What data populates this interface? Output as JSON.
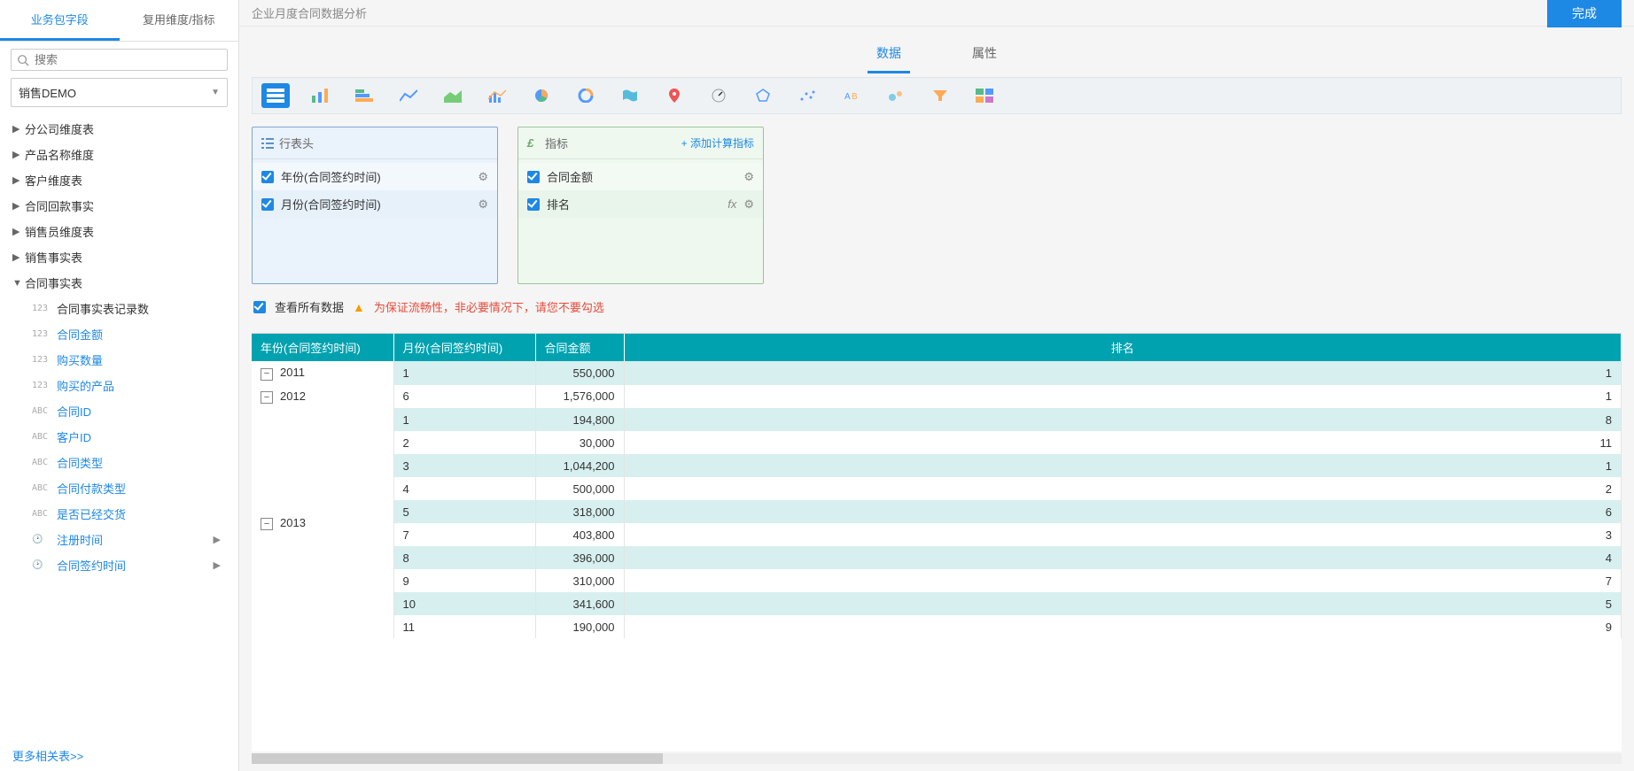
{
  "sidebar": {
    "tabs": [
      "业务包字段",
      "复用维度/指标"
    ],
    "active_tab": 0,
    "search_placeholder": "搜索",
    "dataset_select": "销售DEMO",
    "tree": [
      {
        "label": "分公司维度表",
        "open": false
      },
      {
        "label": "产品名称维度",
        "open": false
      },
      {
        "label": "客户维度表",
        "open": false
      },
      {
        "label": "合同回款事实",
        "open": false
      },
      {
        "label": "销售员维度表",
        "open": false
      },
      {
        "label": "销售事实表",
        "open": false
      },
      {
        "label": "合同事实表",
        "open": true,
        "children": [
          {
            "type": "123",
            "label": "合同事实表记录数",
            "plain": true
          },
          {
            "type": "123",
            "label": "合同金额"
          },
          {
            "type": "123",
            "label": "购买数量"
          },
          {
            "type": "123",
            "label": "购买的产品"
          },
          {
            "type": "ABC",
            "label": "合同ID"
          },
          {
            "type": "ABC",
            "label": "客户ID"
          },
          {
            "type": "ABC",
            "label": "合同类型"
          },
          {
            "type": "ABC",
            "label": "合同付款类型"
          },
          {
            "type": "ABC",
            "label": "是否已经交货"
          },
          {
            "type": "time",
            "label": "注册时间",
            "arrow": true
          },
          {
            "type": "time",
            "label": "合同签约时间",
            "arrow": true
          }
        ]
      }
    ],
    "more_link": "更多相关表>>"
  },
  "header": {
    "title": "企业月度合同数据分析",
    "done": "完成"
  },
  "main_tabs": {
    "items": [
      "数据",
      "属性"
    ],
    "active": 0
  },
  "shelf_row": {
    "title": "行表头",
    "items": [
      {
        "label": "年份(合同签约时间)"
      },
      {
        "label": "月份(合同签约时间)"
      }
    ]
  },
  "shelf_measure": {
    "title": "指标",
    "add": "添加计算指标",
    "items": [
      {
        "label": "合同金额",
        "fx": false
      },
      {
        "label": "排名",
        "fx": true
      }
    ]
  },
  "preview": {
    "label": "查看所有数据",
    "warn": "为保证流畅性，非必要情况下，请您不要勾选"
  },
  "table": {
    "columns": [
      "年份(合同签约时间)",
      "月份(合同签约时间)",
      "合同金额",
      "排名"
    ],
    "groups": [
      {
        "year": "2011",
        "rows": [
          {
            "month": "1",
            "amount": "550,000",
            "rank": "1"
          }
        ]
      },
      {
        "year": "2012",
        "rows": [
          {
            "month": "6",
            "amount": "1,576,000",
            "rank": "1"
          }
        ]
      },
      {
        "year": "2013",
        "rows": [
          {
            "month": "1",
            "amount": "194,800",
            "rank": "8"
          },
          {
            "month": "2",
            "amount": "30,000",
            "rank": "11"
          },
          {
            "month": "3",
            "amount": "1,044,200",
            "rank": "1"
          },
          {
            "month": "4",
            "amount": "500,000",
            "rank": "2"
          },
          {
            "month": "5",
            "amount": "318,000",
            "rank": "6"
          },
          {
            "month": "7",
            "amount": "403,800",
            "rank": "3"
          },
          {
            "month": "8",
            "amount": "396,000",
            "rank": "4"
          },
          {
            "month": "9",
            "amount": "310,000",
            "rank": "7"
          },
          {
            "month": "10",
            "amount": "341,600",
            "rank": "5"
          },
          {
            "month": "11",
            "amount": "190,000",
            "rank": "9"
          }
        ]
      }
    ]
  },
  "chart_types": [
    {
      "name": "table-icon",
      "active": true
    },
    {
      "name": "bar-chart-icon"
    },
    {
      "name": "hbar-chart-icon"
    },
    {
      "name": "line-chart-icon"
    },
    {
      "name": "area-chart-icon"
    },
    {
      "name": "combo-chart-icon"
    },
    {
      "name": "pie-chart-icon"
    },
    {
      "name": "donut-chart-icon"
    },
    {
      "name": "map-icon"
    },
    {
      "name": "point-map-icon"
    },
    {
      "name": "gauge-icon"
    },
    {
      "name": "radar-icon"
    },
    {
      "name": "scatter-icon"
    },
    {
      "name": "text-chart-icon"
    },
    {
      "name": "bubble-icon"
    },
    {
      "name": "funnel-icon"
    },
    {
      "name": "dashboard-icon"
    }
  ]
}
